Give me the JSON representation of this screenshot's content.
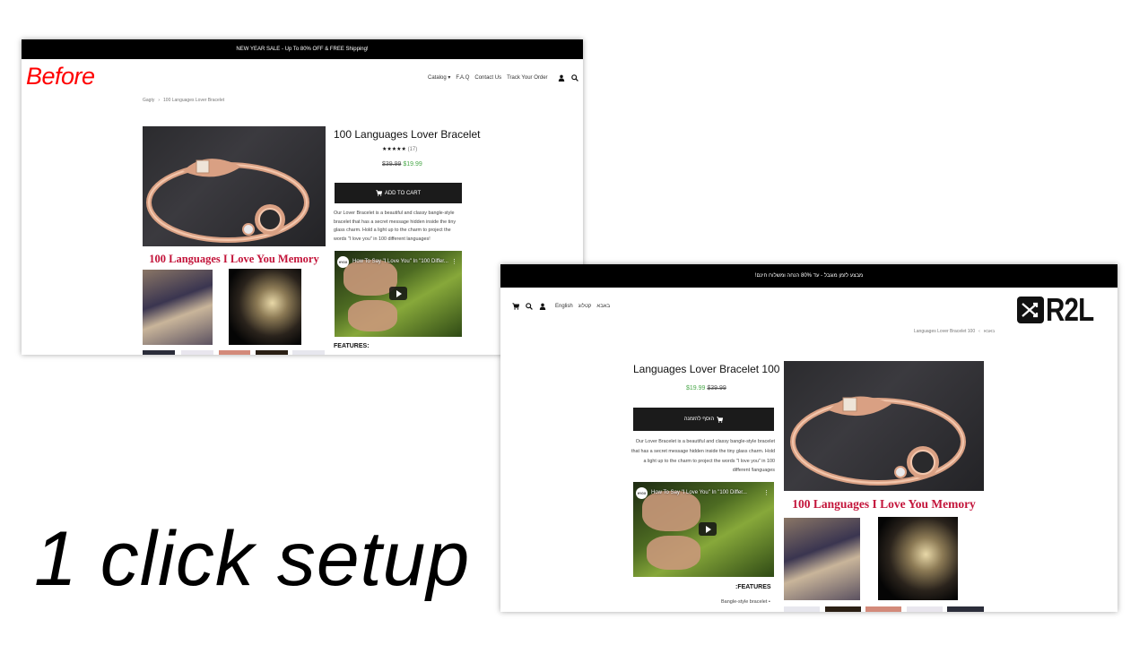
{
  "tagline": "1 click setup",
  "before": {
    "label": "Before",
    "promo": "NEW YEAR SALE - Up To 80% OFF & FREE Shipping!",
    "nav": {
      "items": [
        "Catalog",
        "F.A.Q",
        "Contact Us",
        "Track Your Order"
      ],
      "catalog_caret": "▾",
      "icons": [
        "user-icon",
        "search-icon",
        "cart-icon"
      ]
    },
    "breadcrumb": {
      "home": "Gagty",
      "separator": "›",
      "current": "100 Languages Lover Bracelet"
    },
    "product": {
      "title": "100 Languages Lover Bracelet",
      "stars": "★★★★★",
      "review_count": "(17)",
      "old_price": "$39.99",
      "new_price": "$19.99",
      "add_to_cart": "ADD TO CART",
      "description": "Our Lover Bracelet is a beautiful and classy bangle-style bracelet that has a secret message hidden inside the tiny glass charm. Hold a light up to the charm to project the words \"I love you\" in 100 different languages!",
      "video_title": "How To Say \"I Love You\" In \"100 Differ...",
      "video_channel": "HYGG",
      "features_heading": "FEATURES:",
      "image_banner": "100 Languages I Love You Memory"
    }
  },
  "after": {
    "promo": "מבצע לזמן מוגבל - עד 80% הנחה ומשלוח חינם!",
    "logo_text": "R2L",
    "nav": {
      "items": [
        "באבא",
        "קטלוג",
        "English"
      ],
      "icons": [
        "user-icon",
        "search-icon",
        "cart-icon"
      ]
    },
    "breadcrumb": {
      "home": "באבא",
      "separator": "‹",
      "current": "Languages Lover Bracelet 100"
    },
    "product": {
      "title": "Languages Lover Bracelet 100",
      "new_price": "$19.99",
      "old_price": "$39.99",
      "add_to_cart": "הוסף להזמנה",
      "description": "Our Lover Bracelet is a beautiful and classy bangle-style bracelet that has a secret message hidden inside the tiny glass charm. Hold a light up to the charm to project the words \"I love you\" in 100 different !languages",
      "video_title": "How To Say \"I Love You\" In \"100 Differ...",
      "video_channel": "HYGG",
      "features_heading": ":FEATURES",
      "feature_items": [
        "Bangle-style bracelet"
      ],
      "image_banner": "100 Languages I Love You Memory"
    }
  },
  "colors": {
    "before_label": "#ff0000",
    "promo_bg": "#000000",
    "sale_price": "#4aa84a",
    "banner_text": "#c3143a",
    "button_bg": "#1b1b1b"
  }
}
